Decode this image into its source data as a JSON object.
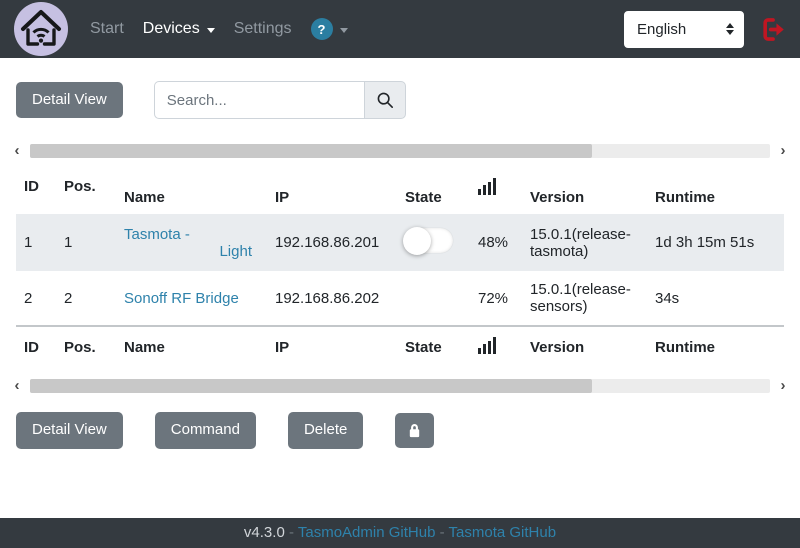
{
  "navbar": {
    "brand_icon": "home-wifi-logo",
    "links": [
      {
        "label": "Start",
        "active": false
      },
      {
        "label": "Devices",
        "active": true
      },
      {
        "label": "Settings",
        "active": false
      }
    ],
    "help": {
      "icon_text": "?",
      "icon_name": "question-mark-icon"
    },
    "language_select": {
      "value": "English"
    },
    "logout_icon": "sign-out-icon",
    "colors": {
      "navbar_bg": "#343a40",
      "help_blue": "#2b7ea1",
      "logout_red": "#c01622",
      "logo_bg": "#c6c0e2"
    }
  },
  "toolbar_top": {
    "detail_view_label": "Detail View",
    "search_placeholder": "Search...",
    "search_icon": "magnifier-icon"
  },
  "table": {
    "header": {
      "id": "ID",
      "pos": "Pos.",
      "name": "Name",
      "ip": "IP",
      "state": "State",
      "signal_icon": "signal-bars-icon",
      "version": "Version",
      "runtime": "Runtime"
    }
  },
  "devices": [
    {
      "id": "1",
      "pos": "1",
      "name_line1": "Tasmota -",
      "name_line2": "Light",
      "ip": "192.168.86.201",
      "state_toggle": "off",
      "signal": "48%",
      "version": "15.0.1(release-tasmota)",
      "runtime": "1d 3h 15m 51s"
    },
    {
      "id": "2",
      "pos": "2",
      "name_line1": "Sonoff RF Bridge",
      "name_line2": "",
      "ip": "192.168.86.202",
      "state_toggle": "none",
      "signal": "72%",
      "version": "15.0.1(release-sensors)",
      "runtime": "34s"
    }
  ],
  "toolbar_bottom": {
    "detail_view_label": "Detail View",
    "command_label": "Command",
    "delete_label": "Delete",
    "lock_icon": "lock-icon"
  },
  "footer": {
    "version": "v4.3.0",
    "separator": "-",
    "tasmoadmin_link": "TasmoAdmin GitHub",
    "tasmota_link": "Tasmota GitHub"
  },
  "colors": {
    "accent_link": "#2e82ab",
    "button_secondary": "#6c757d",
    "row_stripe": "#e9ecef",
    "text": "#212529"
  }
}
